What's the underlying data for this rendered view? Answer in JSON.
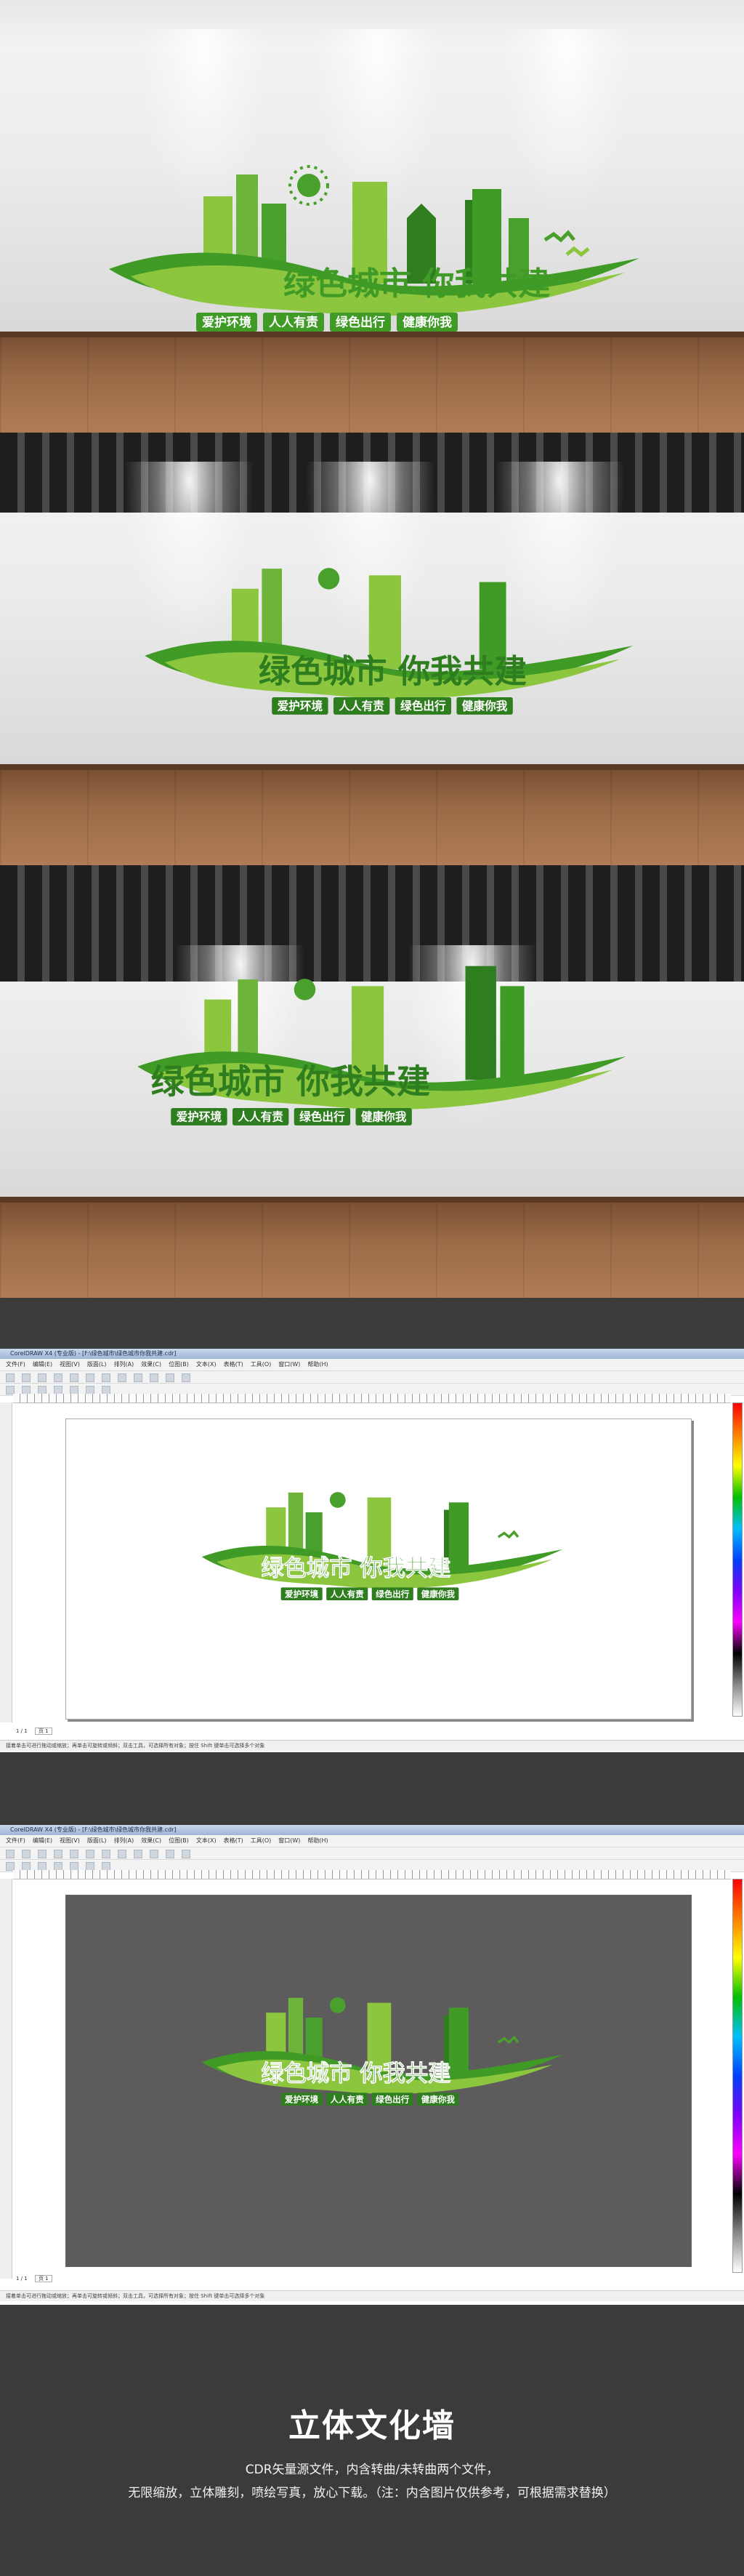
{
  "sign": {
    "slogan": "绿色城市 你我共建",
    "tags": [
      "爱护环境",
      "人人有责",
      "绿色出行",
      "健康你我"
    ],
    "colors": {
      "dark_green": "#2e7d1e",
      "mid_green": "#49a02c",
      "light_green": "#8cc63f",
      "pale_green": "#b5d96b"
    }
  },
  "software": {
    "app_title": "CorelDRAW X4 (专业版) - [F:\\绿色城市\\绿色城市你我共建.cdr]",
    "menu": [
      "文件(F)",
      "编辑(E)",
      "视图(V)",
      "版面(L)",
      "排列(A)",
      "效果(C)",
      "位图(B)",
      "文本(X)",
      "表格(T)",
      "工具(O)",
      "窗口(W)",
      "帮助(H)"
    ],
    "page_indicator": "1 / 1",
    "page_tab": "页 1",
    "status_text": "接着单击可进行拖动或缩放；再单击可旋转或倾斜；双击工具，可选择所有对象；按住 Shift 键单击可选择多个对象",
    "canvas_bg_first": "#ffffff",
    "canvas_bg_second": "#5d5b5b"
  },
  "footer": {
    "title": "立体文化墙",
    "line1": "CDR矢量源文件，内含转曲/未转曲两个文件，",
    "line2": "无限缩放，立体雕刻，喷绘写真，放心下载。（注：内含图片仅供参考，可根据需求替换）"
  }
}
